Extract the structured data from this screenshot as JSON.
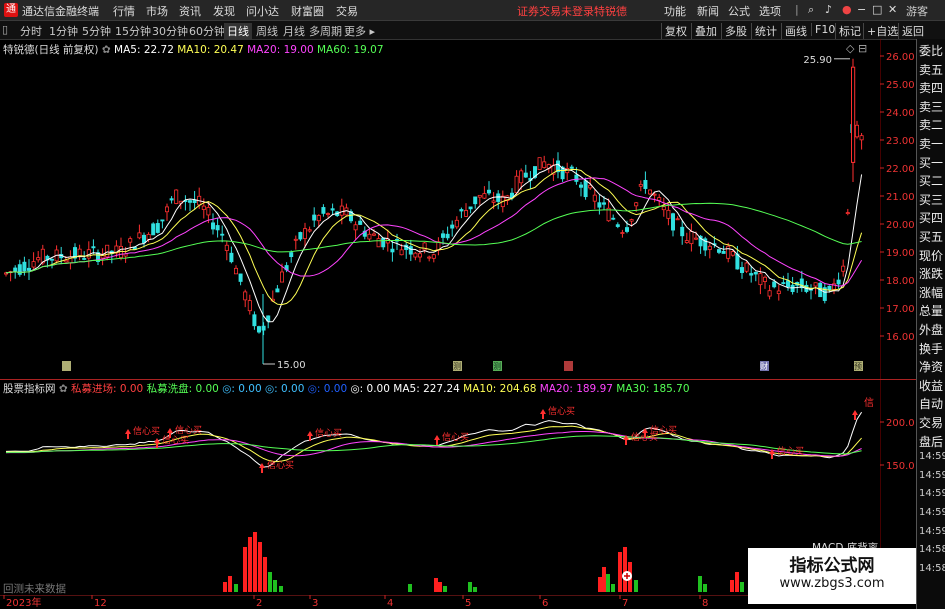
{
  "titlebar": {
    "app_name": "通达信金融终端",
    "logo": "通",
    "menu": [
      "行情",
      "市场",
      "资讯",
      "发现",
      "问小达",
      "财富圈",
      "交易"
    ],
    "warning": "证券交易未登录",
    "stock_name": "特锐德",
    "right_menu": [
      "功能",
      "新闻",
      "公式",
      "选项"
    ],
    "guest": "游客"
  },
  "toolbar": {
    "timeframes": [
      "分时",
      "1分钟",
      "5分钟",
      "15分钟",
      "30分钟",
      "60分钟",
      "日线",
      "周线",
      "月线",
      "多周期",
      "更多 ▸"
    ],
    "active": "日线",
    "right_buttons": [
      "复权",
      "叠加",
      "多股",
      "统计",
      "画线",
      "F10",
      "标记",
      "+自选",
      "返回"
    ]
  },
  "main_chart": {
    "caption": "特锐德(日线 前复权)",
    "ma": [
      {
        "label": "MA5: 22.72",
        "color": "#ffffff"
      },
      {
        "label": "MA10: 20.47",
        "color": "#ffff55"
      },
      {
        "label": "MA20: 19.00",
        "color": "#ff44ff"
      },
      {
        "label": "MA60: 19.07",
        "color": "#55ff55"
      }
    ],
    "y_ticks": [
      "26.00",
      "25.00",
      "24.00",
      "23.00",
      "22.00",
      "21.00",
      "20.00",
      "19.00",
      "18.00",
      "17.00",
      "16.00"
    ],
    "high_marker": "25.90",
    "low_marker": "15.00",
    "event_markers": [
      "测",
      "测",
      "财",
      "预"
    ]
  },
  "indicator": {
    "title": "股票指标网",
    "items": [
      {
        "label": "私募进场: 0.00",
        "color": "#ff4040"
      },
      {
        "label": "私募洗盘: 0.00",
        "color": "#55ff55"
      },
      {
        "label": "◎: 0.00",
        "color": "#40c0ff"
      },
      {
        "label": "◎: 0.00",
        "color": "#40c0ff"
      },
      {
        "label": "◎: 0.00",
        "color": "#2060ff"
      },
      {
        "label": "◎: 0.00",
        "color": "#ffffff"
      },
      {
        "label": "MA5: 227.24",
        "color": "#ffffff"
      },
      {
        "label": "MA10: 204.68",
        "color": "#ffff55"
      },
      {
        "label": "MA20: 189.97",
        "color": "#ff44ff"
      },
      {
        "label": "MA30: 185.70",
        "color": "#55ff55"
      }
    ],
    "y_ticks": [
      "200.0",
      "150.0"
    ],
    "signal": "信心买",
    "signal_short": "信"
  },
  "volume": {
    "macd_label": "MACD 底背离",
    "bottom_left": "回测未来数据"
  },
  "x_axis": [
    "2023年",
    "12",
    "2",
    "3",
    "4",
    "5",
    "6",
    "7",
    "8"
  ],
  "sidebar": [
    "委比",
    "卖五",
    "卖四",
    "卖三",
    "卖二",
    "卖一",
    "买一",
    "买二",
    "买三",
    "买四",
    "买五",
    "现价",
    "涨跌",
    "涨幅",
    "总量",
    "外盘",
    "换手",
    "净资",
    "收益",
    "自动",
    "交易",
    "盘后",
    "14:59",
    "14:59",
    "14:59",
    "14:59",
    "14:59",
    "14:58",
    "14:58"
  ],
  "watermark": {
    "line1": "指标公式网",
    "line2": "www.zbgs3.com"
  },
  "colors": {
    "up": "#ff3030",
    "down": "#30e0e0",
    "ma5": "#ffffff",
    "ma10": "#ffff55",
    "ma20": "#ff44ff",
    "ma60": "#55ff55"
  }
}
